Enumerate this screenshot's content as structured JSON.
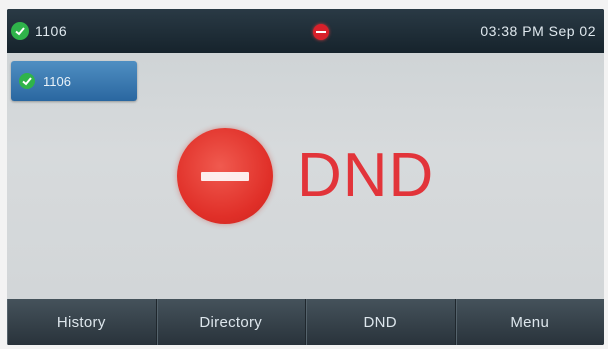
{
  "status_bar": {
    "account_label": "1106",
    "datetime": "03:38 PM Sep 02"
  },
  "line_key": {
    "label": "1106"
  },
  "idle_screen": {
    "dnd_label": "DND"
  },
  "softkeys": [
    {
      "label": "History"
    },
    {
      "label": "Directory"
    },
    {
      "label": "DND"
    },
    {
      "label": "Menu"
    }
  ],
  "colors": {
    "dnd_red": "#e2343a",
    "registered_green": "#2fb34a",
    "line_key_blue": "#2a67a0"
  }
}
